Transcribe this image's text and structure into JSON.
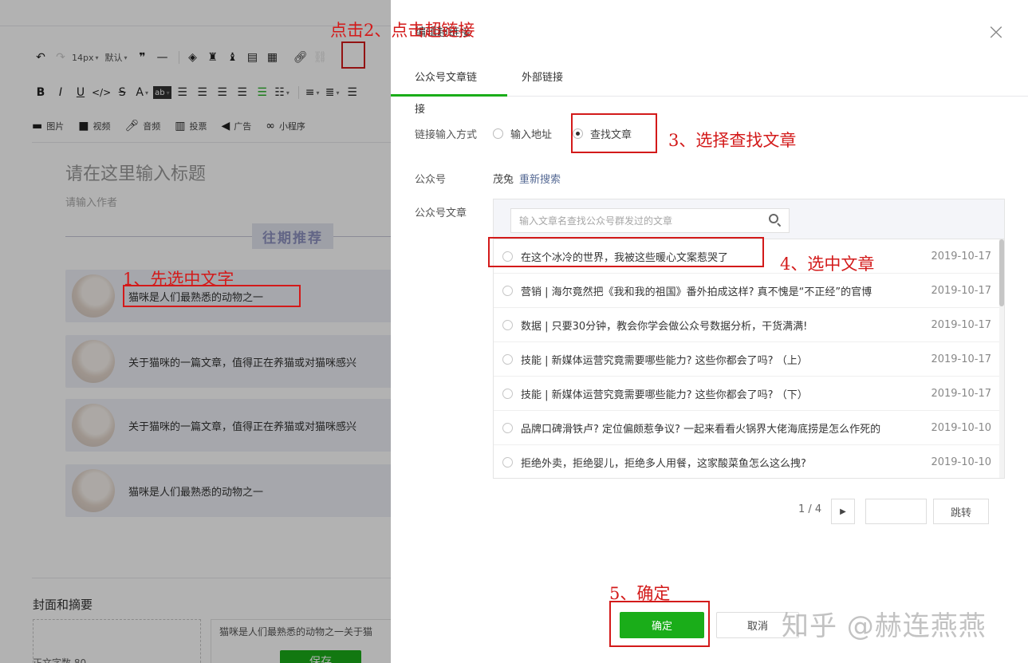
{
  "toolbar": {
    "row1": {
      "font_size": "14px",
      "font_family": "默认"
    },
    "media": [
      {
        "icon": "image-icon",
        "label": "图片"
      },
      {
        "icon": "video-icon",
        "label": "视频"
      },
      {
        "icon": "audio-icon",
        "label": "音频"
      },
      {
        "icon": "vote-icon",
        "label": "投票"
      },
      {
        "icon": "ad-icon",
        "label": "广告"
      },
      {
        "icon": "mini-program-icon",
        "label": "小程序"
      }
    ]
  },
  "editor": {
    "title_placeholder": "请在这里输入标题",
    "author_placeholder": "请输入作者",
    "recommend_label": "往期推荐",
    "cards": [
      "猫咪是人们最熟悉的动物之一",
      "关于猫咪的一篇文章，值得正在养猫或对猫咪感兴",
      "关于猫咪的一篇文章，值得正在养猫或对猫咪感兴",
      "猫咪是人们最熟悉的动物之一"
    ],
    "cover_title": "封面和摘要",
    "summary_text": "猫咪是人们最熟悉的动物之一关于猫",
    "word_count": "正文字数 80",
    "save_label": "保存"
  },
  "dialog": {
    "title": "编辑超链接",
    "tabs": [
      "公众号文章链接",
      "外部链接"
    ],
    "input_mode_label": "链接输入方式",
    "radio_address": "输入地址",
    "radio_find": "查找文章",
    "account_label": "公众号",
    "account_name": "茂兔",
    "research_link": "重新搜索",
    "articles_label": "公众号文章",
    "search_placeholder": "输入文章名查找公众号群发过的文章",
    "articles": [
      {
        "title": "在这个冰冷的世界，我被这些暖心文案惹哭了",
        "date": "2019-10-17"
      },
      {
        "title": "营销 | 海尔竟然把《我和我的祖国》番外拍成这样? 真不愧是“不正经”的官博",
        "date": "2019-10-17"
      },
      {
        "title": "数据 | 只要30分钟，教会你学会做公众号数据分析，干货满满!",
        "date": "2019-10-17"
      },
      {
        "title": "技能 | 新媒体运营究竟需要哪些能力? 这些你都会了吗? （上）",
        "date": "2019-10-17"
      },
      {
        "title": "技能 | 新媒体运营究竟需要哪些能力? 这些你都会了吗? （下）",
        "date": "2019-10-17"
      },
      {
        "title": "品牌口碑滑铁卢? 定位偏颇惹争议? 一起来看看火锅界大佬海底捞是怎么作死的",
        "date": "2019-10-10"
      },
      {
        "title": "拒绝外卖，拒绝婴儿，拒绝多人用餐，这家酸菜鱼怎么这么拽?",
        "date": "2019-10-10"
      }
    ],
    "pager_text": "1 / 4",
    "jump_label": "跳转",
    "ok_label": "确定",
    "cancel_label": "取消"
  },
  "annotations": {
    "step1": "1、先选中文字",
    "step2": "点击2、点击超链接",
    "step3": "3、选择查找文章",
    "step4": "4、选中文章",
    "step5": "5、确定"
  },
  "watermark": "知乎 @赫连燕燕",
  "colors": {
    "accent_green": "#1aad19",
    "annotation_red": "#d31a1a",
    "link_blue": "#576b95"
  }
}
